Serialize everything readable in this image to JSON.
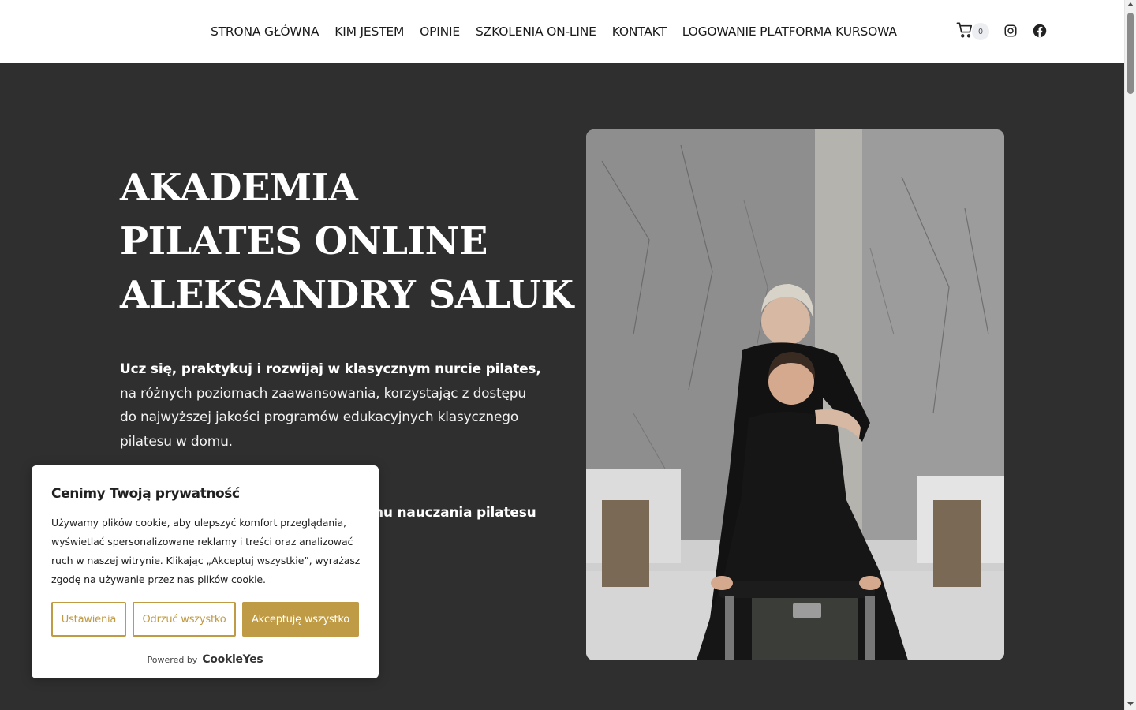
{
  "nav": {
    "items": [
      {
        "label": "STRONA GŁÓWNA"
      },
      {
        "label": "KIM JESTEM"
      },
      {
        "label": "OPINIE"
      },
      {
        "label": "SZKOLENIA ON-LINE"
      },
      {
        "label": "KONTAKT"
      },
      {
        "label": "LOGOWANIE PLATFORMA KURSOWA"
      }
    ]
  },
  "header": {
    "cart_count": "0",
    "icons": [
      "cart-icon",
      "instagram-icon",
      "facebook-icon"
    ]
  },
  "hero": {
    "title_lines": [
      "AKADEMIA",
      "PILATES ONLINE",
      "ALEKSANDRY SALUK"
    ],
    "intro_bold": "Ucz się, praktykuj i rozwijaj w klasycznym nurcie pilates,",
    "intro_rest": "na różnych poziomach zaawansowania, korzystając z dostępu do najwyższej jakości programów edukacyjnych klasycznego pilatesu w domu.",
    "second_partial": "nu nauczania pilatesu"
  },
  "cookie": {
    "title": "Cenimy Twoją prywatność",
    "text": "Używamy plików cookie, aby ulepszyć komfort przeglądania, wyświetlać spersonalizowane reklamy i treści oraz analizować ruch w naszej witrynie. Klikając „Akceptuj wszystkie”, wyrażasz zgodę na używanie przez nas plików cookie.",
    "btn_settings": "Ustawienia",
    "btn_reject": "Odrzuć wszystko",
    "btn_accept": "Akceptuję wszystko",
    "powered_label": "Powered by",
    "powered_brand": "CookieYes"
  },
  "colors": {
    "hero_bg": "#2f2f2f",
    "accent": "#c09b45"
  }
}
